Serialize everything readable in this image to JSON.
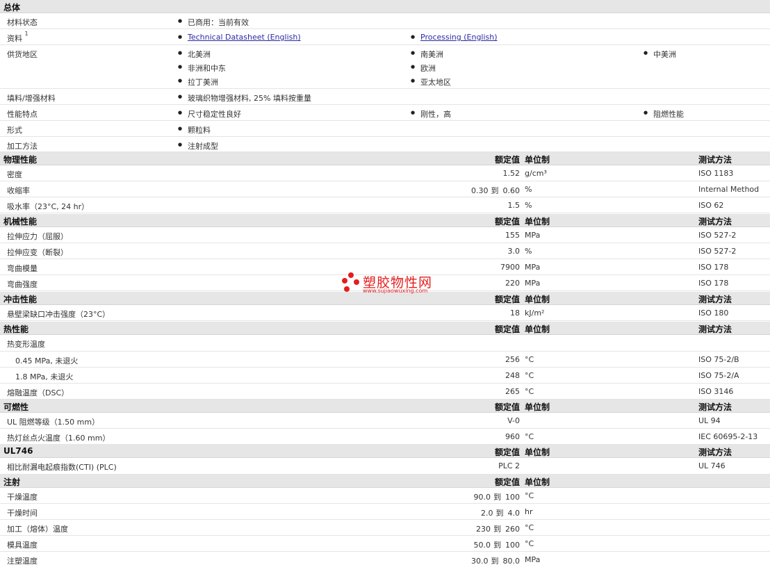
{
  "sections": {
    "general": "总体",
    "physical": "物理性能",
    "mechanical": "机械性能",
    "impact": "冲击性能",
    "thermal": "热性能",
    "flammability": "可燃性",
    "ul746": "UL746",
    "injection": "注射"
  },
  "headers": {
    "nominal": "额定值",
    "unit": "单位制",
    "method": "测试方法"
  },
  "range_word": "到",
  "general": {
    "status_label": "材料状态",
    "status_value": "已商用：当前有效",
    "docs_label": "资料",
    "docs_sup": "1",
    "doc1": "Technical Datasheet (English)",
    "doc2": "Processing (English)",
    "regions_label": "供货地区",
    "regions": [
      "北美洲",
      "南美洲",
      "中美洲",
      "非洲和中东",
      "欧洲",
      "拉丁美洲",
      "亚太地区"
    ],
    "filler_label": "填料/增强材料",
    "filler_value": "玻璃织物增强材料, 25% 填料按重量",
    "features_label": "性能特点",
    "features": [
      "尺寸稳定性良好",
      "刚性，高",
      "阻燃性能"
    ],
    "form_label": "形式",
    "form_value": "颗粒料",
    "process_label": "加工方法",
    "process_value": "注射成型"
  },
  "physical": [
    {
      "name": "密度",
      "value": "1.52",
      "unit": "g/cm³",
      "method": "ISO 1183"
    },
    {
      "name": "收缩率",
      "from": "0.30",
      "to": "0.60",
      "unit": "%",
      "method": "Internal Method"
    },
    {
      "name": "吸水率（23°C, 24 hr）",
      "value": "1.5",
      "unit": "%",
      "method": "ISO 62"
    }
  ],
  "mechanical": [
    {
      "name": "拉伸应力（屈服）",
      "value": "155",
      "unit": "MPa",
      "method": "ISO 527-2"
    },
    {
      "name": "拉伸应变（断裂）",
      "value": "3.0",
      "unit": "%",
      "method": "ISO 527-2"
    },
    {
      "name": "弯曲模量",
      "value": "7900",
      "unit": "MPa",
      "method": "ISO 178"
    },
    {
      "name": "弯曲强度",
      "value": "220",
      "unit": "MPa",
      "method": "ISO 178"
    }
  ],
  "impact": [
    {
      "name": "悬壁梁缺口冲击强度（23°C）",
      "value": "18",
      "unit": "kJ/m²",
      "method": "ISO 180"
    }
  ],
  "thermal": {
    "hdt_label": "热变形温度",
    "rows": [
      {
        "name": "0.45 MPa, 未退火",
        "value": "256",
        "unit": "°C",
        "method": "ISO 75-2/B"
      },
      {
        "name": "1.8 MPa, 未退火",
        "value": "248",
        "unit": "°C",
        "method": "ISO 75-2/A"
      },
      {
        "name": "熔融温度（DSC）",
        "value": "265",
        "unit": "°C",
        "method": "ISO 3146"
      }
    ]
  },
  "flammability": [
    {
      "name": "UL 阻燃等级（1.50 mm）",
      "value": "V-0",
      "unit": "",
      "method": "UL 94"
    },
    {
      "name": "热灯丝点火温度（1.60 mm）",
      "value": "960",
      "unit": "°C",
      "method": "IEC 60695-2-13"
    }
  ],
  "ul746": [
    {
      "name": "相比耐漏电起痕指数(CTI) (PLC)",
      "value": "PLC 2",
      "unit": "",
      "method": "UL 746"
    }
  ],
  "injection": [
    {
      "name": "干燥温度",
      "from": "90.0",
      "to": "100",
      "unit": "°C"
    },
    {
      "name": "干燥时间",
      "from": "2.0",
      "to": "4.0",
      "unit": "hr"
    },
    {
      "name": "加工（熔体）温度",
      "from": "230",
      "to": "260",
      "unit": "°C"
    },
    {
      "name": "模具温度",
      "from": "50.0",
      "to": "100",
      "unit": "°C"
    },
    {
      "name": "注塑温度",
      "from": "30.0",
      "to": "80.0",
      "unit": "MPa"
    }
  ],
  "watermark": {
    "name": "塑胶物性网",
    "url": "www.sujiaowuxing.com",
    "color": "#e41e1e"
  }
}
